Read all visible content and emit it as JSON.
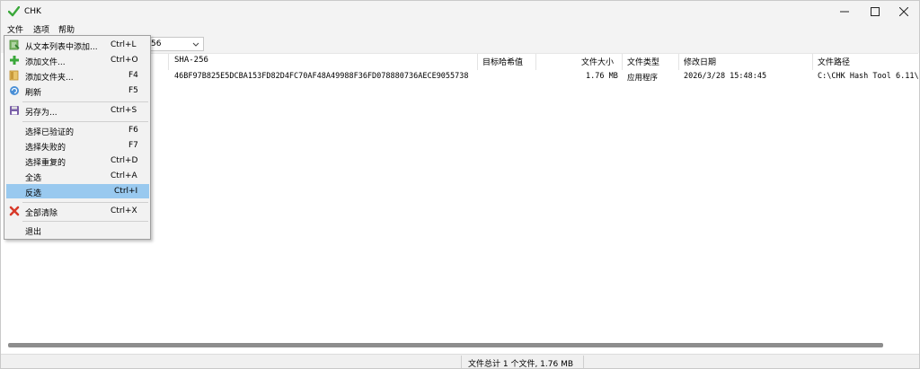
{
  "window": {
    "title": "CHK",
    "app_icon": "green-check-icon",
    "controls": {
      "minimize": "—",
      "maximize": "☐",
      "close": "✕"
    }
  },
  "menubar": {
    "items": [
      "文件",
      "选项",
      "帮助"
    ]
  },
  "toolbar": {
    "algorithm_fragment": "56"
  },
  "columns": [
    "SHA-256",
    "目标哈希值",
    "文件大小",
    "文件类型",
    "修改日期",
    "文件路径"
  ],
  "rows": [
    {
      "sha256": "46BF97B825E5DCBA153FD82D4FC70AF48A49988F36FD078880736AECE9055738",
      "target": "",
      "size": "1.76 MB",
      "type": "应用程序",
      "modified": "2026/3/28 15:48:45",
      "path": "C:\\CHK Hash Tool 6.11\\"
    }
  ],
  "file_menu": {
    "items": [
      {
        "label": "从文本列表中添加...",
        "shortcut": "Ctrl+L",
        "icon": "add-from-list-icon"
      },
      {
        "label": "添加文件...",
        "shortcut": "Ctrl+O",
        "icon": "plus-icon"
      },
      {
        "label": "添加文件夹...",
        "shortcut": "F4",
        "icon": "folder-icon"
      },
      {
        "label": "刷新",
        "shortcut": "F5",
        "icon": "refresh-icon"
      },
      {
        "label": "另存为...",
        "shortcut": "Ctrl+S",
        "icon": "save-icon"
      },
      {
        "label": "选择已验证的",
        "shortcut": "F6",
        "icon": ""
      },
      {
        "label": "选择失败的",
        "shortcut": "F7",
        "icon": ""
      },
      {
        "label": "选择重复的",
        "shortcut": "Ctrl+D",
        "icon": ""
      },
      {
        "label": "全选",
        "shortcut": "Ctrl+A",
        "icon": ""
      },
      {
        "label": "反选",
        "shortcut": "Ctrl+I",
        "icon": "",
        "highlighted": true
      },
      {
        "label": "全部清除",
        "shortcut": "Ctrl+X",
        "icon": "red-x-icon"
      },
      {
        "label": "退出",
        "shortcut": "",
        "icon": ""
      }
    ]
  },
  "status": {
    "summary": "文件总计 1 个文件, 1.76 MB"
  },
  "colors": {
    "highlight": "#99c9ef",
    "check_green": "#3aa83a",
    "clear_red": "#d83a2a"
  }
}
